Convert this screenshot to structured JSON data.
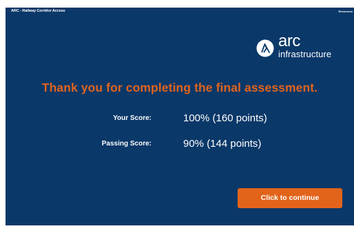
{
  "window": {
    "course_title": "ARC - Railway Corridor Access",
    "top_right_link": "Resources"
  },
  "brand": {
    "logo_word": "arc",
    "logo_sub": "infrastructure"
  },
  "main": {
    "headline": "Thank you for completing the final assessment.",
    "your_score_label": "Your Score:",
    "your_score_value": "100% (160 points)",
    "passing_score_label": "Passing Score:",
    "passing_score_value": "90% (144 points)",
    "continue_label": "Click to continue"
  },
  "player": {
    "menu_icon": "menu-icon",
    "play_icon": "play-icon",
    "settings_icon": "settings-icon"
  },
  "colors": {
    "background": "#0a3869",
    "accent": "#e2641b",
    "headline": "#e0641e",
    "text": "#ffffff"
  }
}
